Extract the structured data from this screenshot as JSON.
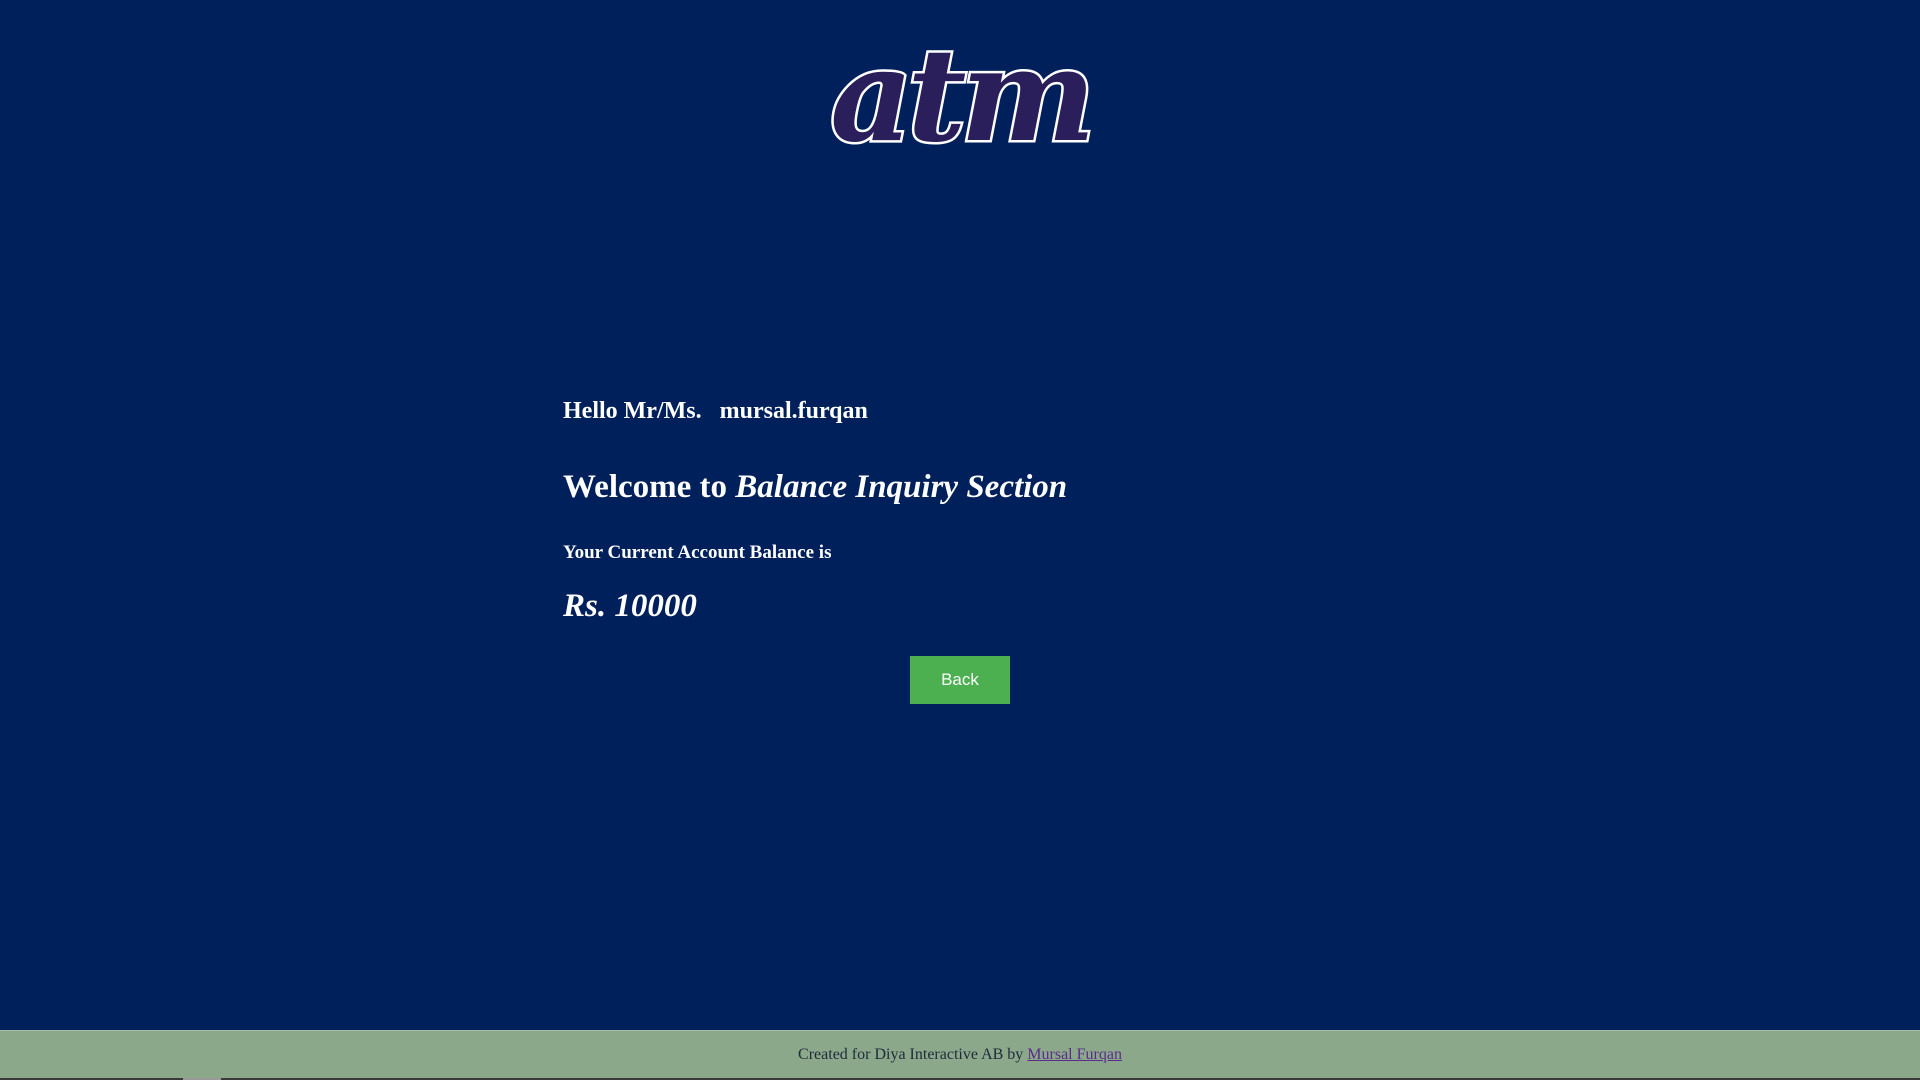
{
  "logo": {
    "text": "atm",
    "colors": {
      "outline": "#ffffff",
      "fill": "#2a1f5a"
    }
  },
  "greeting": {
    "prefix": "Hello Mr/Ms.",
    "username": "mursal.furqan"
  },
  "welcome": {
    "prefix": "Welcome to",
    "section_name": "Balance Inquiry Section"
  },
  "balance": {
    "label": "Your Current Account Balance is",
    "amount": "Rs. 10000"
  },
  "actions": {
    "back_label": "Back"
  },
  "footer": {
    "text": "Created for Diya Interactive AB by",
    "author_link": "Mursal Furqan"
  },
  "colors": {
    "background": "#00205b",
    "button": "#4caf50",
    "footer_background": "#8ba88b",
    "link": "#5b2c8c"
  }
}
